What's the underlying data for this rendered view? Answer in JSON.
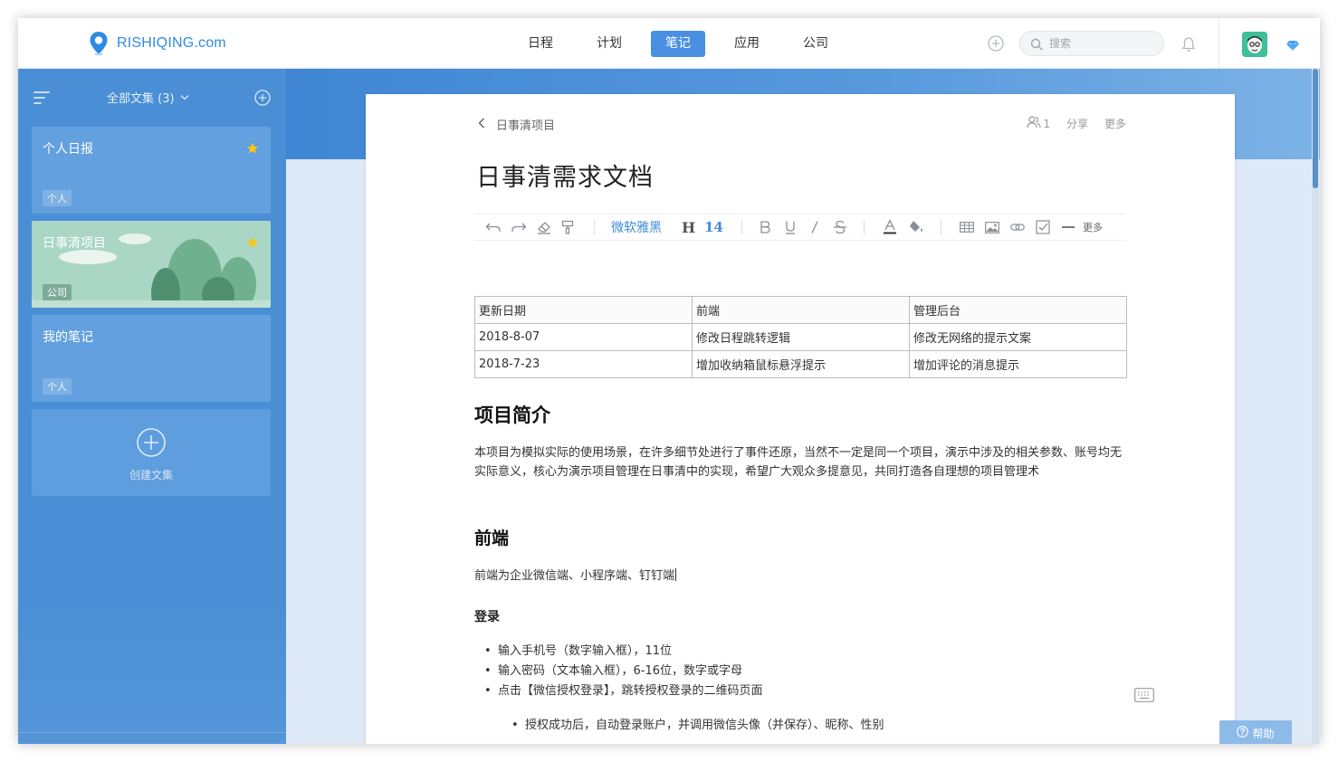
{
  "header": {
    "logo_text": "RISHIQING.com",
    "nav": [
      {
        "label": "日程"
      },
      {
        "label": "计划"
      },
      {
        "label": "笔记"
      },
      {
        "label": "应用"
      },
      {
        "label": "公司"
      }
    ],
    "active_nav": "笔记",
    "search_placeholder": "搜索"
  },
  "sidebar": {
    "collection_title": "全部文集 (3)",
    "notebooks": [
      {
        "title": "个人日报",
        "tag": "个人",
        "starred": true
      },
      {
        "title": "日事清项目",
        "tag": "公司",
        "starred": true,
        "selected": true
      },
      {
        "title": "我的笔记",
        "tag": "个人",
        "starred": false
      }
    ],
    "create_label": "创建文集"
  },
  "doc": {
    "breadcrumb": "日事清项目",
    "collaborators": "1",
    "share_label": "分享",
    "more_label": "更多",
    "title": "日事清需求文档",
    "toolbar": {
      "font_name": "微软雅黑",
      "heading": "H",
      "font_size": "14",
      "more_label": "更多"
    },
    "table": {
      "headers": [
        "更新日期",
        "前端",
        "管理后台"
      ],
      "rows": [
        [
          "2018-8-07",
          "修改日程跳转逻辑",
          "修改无网络的提示文案"
        ],
        [
          "2018-7-23",
          "增加收纳箱鼠标悬浮提示",
          "增加评论的消息提示"
        ]
      ]
    },
    "intro_heading": "项目简介",
    "intro_text": "本项目为模拟实际的使用场景，在许多细节处进行了事件还原，当然不一定是同一个项目，演示中涉及的相关参数、账号均无实际意义，核心为演示项目管理在日事清中的实现，希望广大观众多提意见，共同打造各自理想的项目管理术",
    "frontend_heading": "前端",
    "frontend_text": "前端为企业微信端、小程序端、钉钉端",
    "login_heading": "登录",
    "login_items": [
      "输入手机号（数字输入框），11位",
      "输入密码（文本输入框），6-16位，数字或字母",
      "点击【微信授权登录】，跳转授权登录的二维码页面"
    ],
    "login_subitems": [
      "授权成功后，自动登录账户，并调用微信头像（并保存）、昵称、性别"
    ]
  },
  "help_label": "帮助",
  "colors": {
    "brand": "#2f8ae5",
    "active_nav": "#4a90e2",
    "sidebar": "#4a8fd6",
    "star": "#f5c518"
  },
  "icons": [
    "logo-pin-icon",
    "plus-circle-icon",
    "search-icon",
    "bell-icon",
    "avatar",
    "diamond-icon",
    "menu-lines-icon",
    "chevron-down-icon",
    "star-icon",
    "back-chevron-icon",
    "collaborator-icon",
    "undo-icon",
    "redo-icon",
    "eraser-icon",
    "format-painter-icon",
    "bold-icon",
    "underline-icon",
    "italic-icon",
    "strikethrough-icon",
    "font-color-icon",
    "fill-color-icon",
    "table-icon",
    "image-icon",
    "link-icon",
    "checkbox-icon",
    "divider-icon",
    "keyboard-icon",
    "help-icon"
  ]
}
